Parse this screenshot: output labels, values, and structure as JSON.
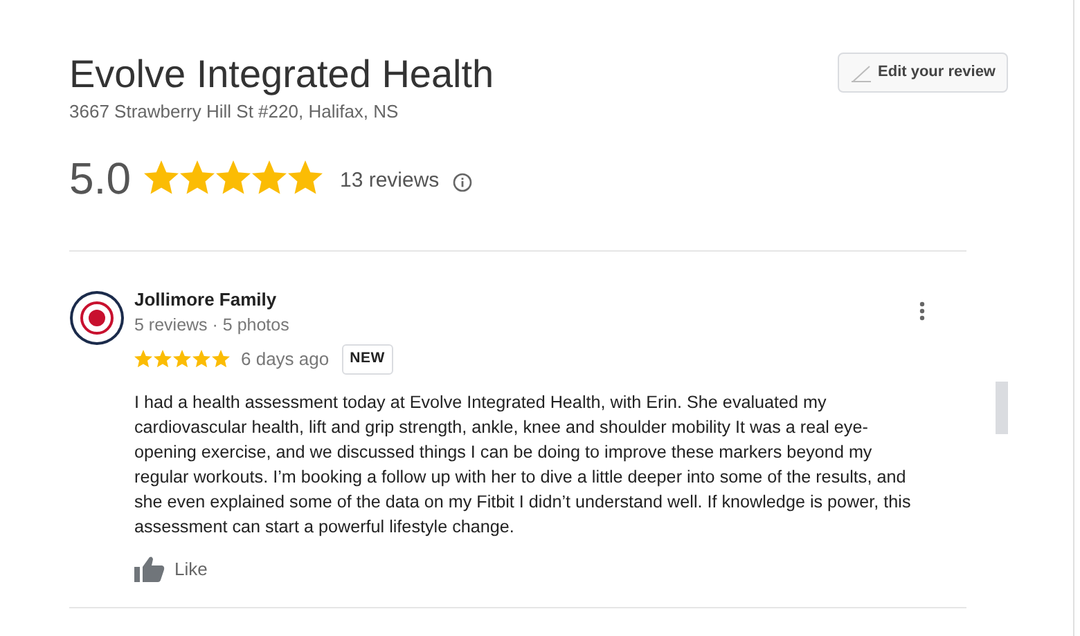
{
  "place": {
    "name": "Evolve Integrated Health",
    "address": "3667 Strawberry Hill St #220, Halifax, NS",
    "edit_button": "Edit your review",
    "rating": "5.0",
    "stars": 5,
    "review_count": "13 reviews"
  },
  "reviews": [
    {
      "author": "Jollimore Family",
      "meta": "5 reviews · 5 photos",
      "stars": 5,
      "time": "6 days ago",
      "badge": "NEW",
      "text": "I had a health assessment today at Evolve Integrated Health, with Erin. She evaluated my cardiovascular health, lift and grip strength, ankle, knee and shoulder mobility It was a real eye-opening exercise, and we discussed things I can be doing to improve these markers beyond my regular workouts. I’m booking a follow up with her to dive a little deeper into some of the results, and she even explained some of the data on my Fitbit I didn’t understand well. If knowledge is power, this assessment can start a powerful lifestyle change.",
      "like": "Like"
    }
  ]
}
